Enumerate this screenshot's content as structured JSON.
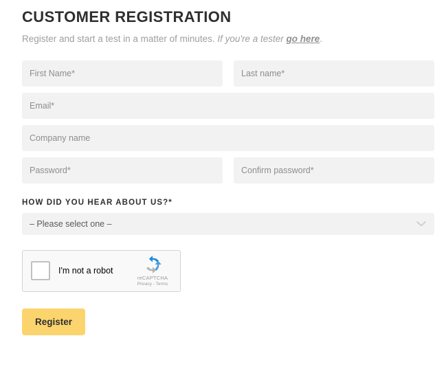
{
  "header": {
    "title": "CUSTOMER REGISTRATION",
    "subtitle_lead": "Register and start a test in a matter of minutes.",
    "subtitle_tester": "If you're a tester",
    "subtitle_link": "go here",
    "subtitle_period": "."
  },
  "form": {
    "first_name": {
      "placeholder": "First Name*",
      "value": ""
    },
    "last_name": {
      "placeholder": "Last name*",
      "value": ""
    },
    "email": {
      "placeholder": "Email*",
      "value": ""
    },
    "company": {
      "placeholder": "Company name",
      "value": ""
    },
    "password": {
      "placeholder": "Password*",
      "value": ""
    },
    "confirm_password": {
      "placeholder": "Confirm password*",
      "value": ""
    },
    "referral": {
      "label": "HOW DID YOU HEAR ABOUT US?*",
      "selected": "– Please select one –",
      "chevron_icon": "chevron-down-icon"
    }
  },
  "recaptcha": {
    "checkbox_state": "unchecked",
    "label": "I'm not a robot",
    "brand_name": "reCAPTCHA",
    "legal": "Privacy - Terms",
    "logo_icon": "recaptcha-logo-icon"
  },
  "actions": {
    "submit_label": "Register"
  },
  "colors": {
    "accent": "#fbd46d",
    "field_bg": "#f2f2f2",
    "text_dark": "#2f2f2f",
    "text_muted": "#9e9e9e",
    "page_bg": "#ffffff"
  }
}
